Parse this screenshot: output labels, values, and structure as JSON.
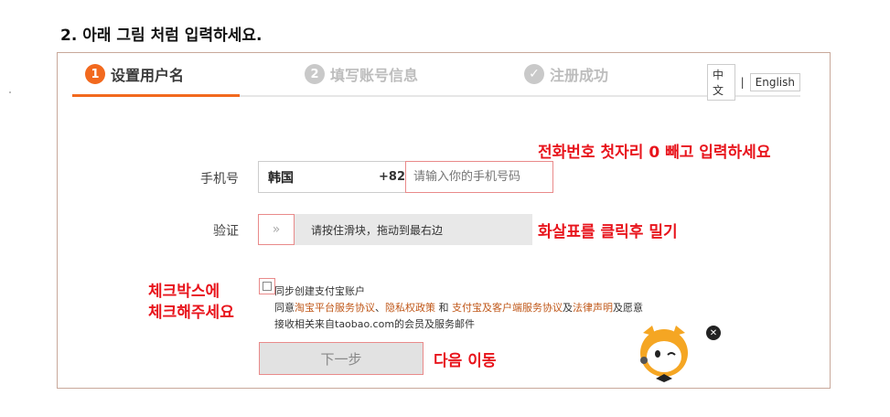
{
  "heading": "2. 아래 그림 처럼 입력하세요.",
  "steps": [
    {
      "num": "1",
      "label": "设置用户名"
    },
    {
      "num": "2",
      "label": "填写账号信息"
    },
    {
      "num": "✓",
      "label": "注册成功"
    }
  ],
  "lang": {
    "chinese": "中文",
    "english": "English",
    "sep": "|"
  },
  "phone": {
    "label": "手机号",
    "country": "韩国",
    "code": "+82",
    "placeholder": "请输入你的手机号码"
  },
  "verify": {
    "label": "验证",
    "handle": "»",
    "text": "请按住滑块，拖动到最右边"
  },
  "agreement": {
    "checkbox_label": "同步创建支付宝账户",
    "line2_prefix": "同意",
    "link1": "淘宝平台服务协议",
    "sep1": "、",
    "link2": "隐私权政策",
    "and": " 和 ",
    "link3": "支付宝及客户端服务协议",
    "mid": "及",
    "link4": "法律声明",
    "suffix": "及愿意",
    "line3": "接收相关来自taobao.com的会员及服务邮件"
  },
  "next_button": "下一步",
  "annotations": {
    "phone": "전화번호 첫자리 0 빼고 입력하세요",
    "slider": "화살표를 클릭후 밀기",
    "checkbox_line1": "체크박스에",
    "checkbox_line2": "체크해주세요",
    "next": "다음 이동"
  },
  "colors": {
    "accent": "#f2691e",
    "annotation": "#e8141c",
    "link": "#c0581a"
  }
}
